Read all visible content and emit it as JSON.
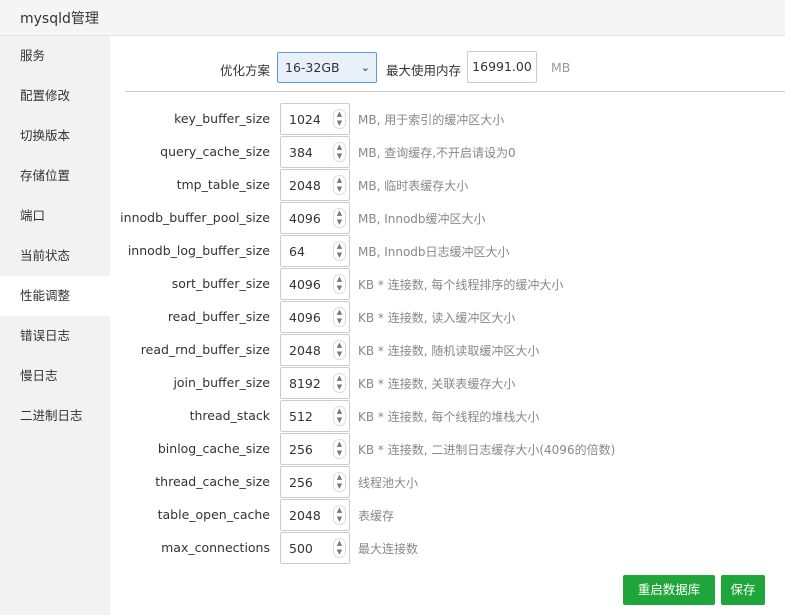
{
  "window": {
    "title": "mysqld管理"
  },
  "sidebar": {
    "items": [
      {
        "label": "服务",
        "active": false
      },
      {
        "label": "配置修改",
        "active": false
      },
      {
        "label": "切换版本",
        "active": false
      },
      {
        "label": "存储位置",
        "active": false
      },
      {
        "label": "端口",
        "active": false
      },
      {
        "label": "当前状态",
        "active": false
      },
      {
        "label": "性能调整",
        "active": true
      },
      {
        "label": "错误日志",
        "active": false
      },
      {
        "label": "慢日志",
        "active": false
      },
      {
        "label": "二进制日志",
        "active": false
      }
    ]
  },
  "top": {
    "plan_label": "优化方案",
    "plan_value": "16-32GB",
    "mem_label": "最大使用内存",
    "mem_value": "16991.00",
    "mem_unit": "MB"
  },
  "params": [
    {
      "name": "key_buffer_size",
      "value": "1024",
      "desc": "MB, 用于索引的缓冲区大小"
    },
    {
      "name": "query_cache_size",
      "value": "384",
      "desc": "MB, 查询缓存,不开启请设为0"
    },
    {
      "name": "tmp_table_size",
      "value": "2048",
      "desc": "MB, 临时表缓存大小"
    },
    {
      "name": "innodb_buffer_pool_size",
      "value": "4096",
      "desc": "MB, Innodb缓冲区大小"
    },
    {
      "name": "innodb_log_buffer_size",
      "value": "64",
      "desc": "MB, Innodb日志缓冲区大小"
    },
    {
      "name": "sort_buffer_size",
      "value": "4096",
      "desc": "KB * 连接数, 每个线程排序的缓冲大小"
    },
    {
      "name": "read_buffer_size",
      "value": "4096",
      "desc": "KB * 连接数, 读入缓冲区大小"
    },
    {
      "name": "read_rnd_buffer_size",
      "value": "2048",
      "desc": "KB * 连接数, 随机读取缓冲区大小"
    },
    {
      "name": "join_buffer_size",
      "value": "8192",
      "desc": "KB * 连接数, 关联表缓存大小"
    },
    {
      "name": "thread_stack",
      "value": "512",
      "desc": "KB * 连接数, 每个线程的堆栈大小"
    },
    {
      "name": "binlog_cache_size",
      "value": "256",
      "desc": "KB * 连接数, 二进制日志缓存大小(4096的倍数)"
    },
    {
      "name": "thread_cache_size",
      "value": "256",
      "desc": "线程池大小"
    },
    {
      "name": "table_open_cache",
      "value": "2048",
      "desc": "表缓存"
    },
    {
      "name": "max_connections",
      "value": "500",
      "desc": "最大连接数"
    }
  ],
  "buttons": {
    "restart": "重启数据库",
    "save": "保存"
  },
  "colors": {
    "accent": "#20a53a",
    "sidebar_bg": "#f2f2f2",
    "select_border": "#5b9bd5"
  }
}
